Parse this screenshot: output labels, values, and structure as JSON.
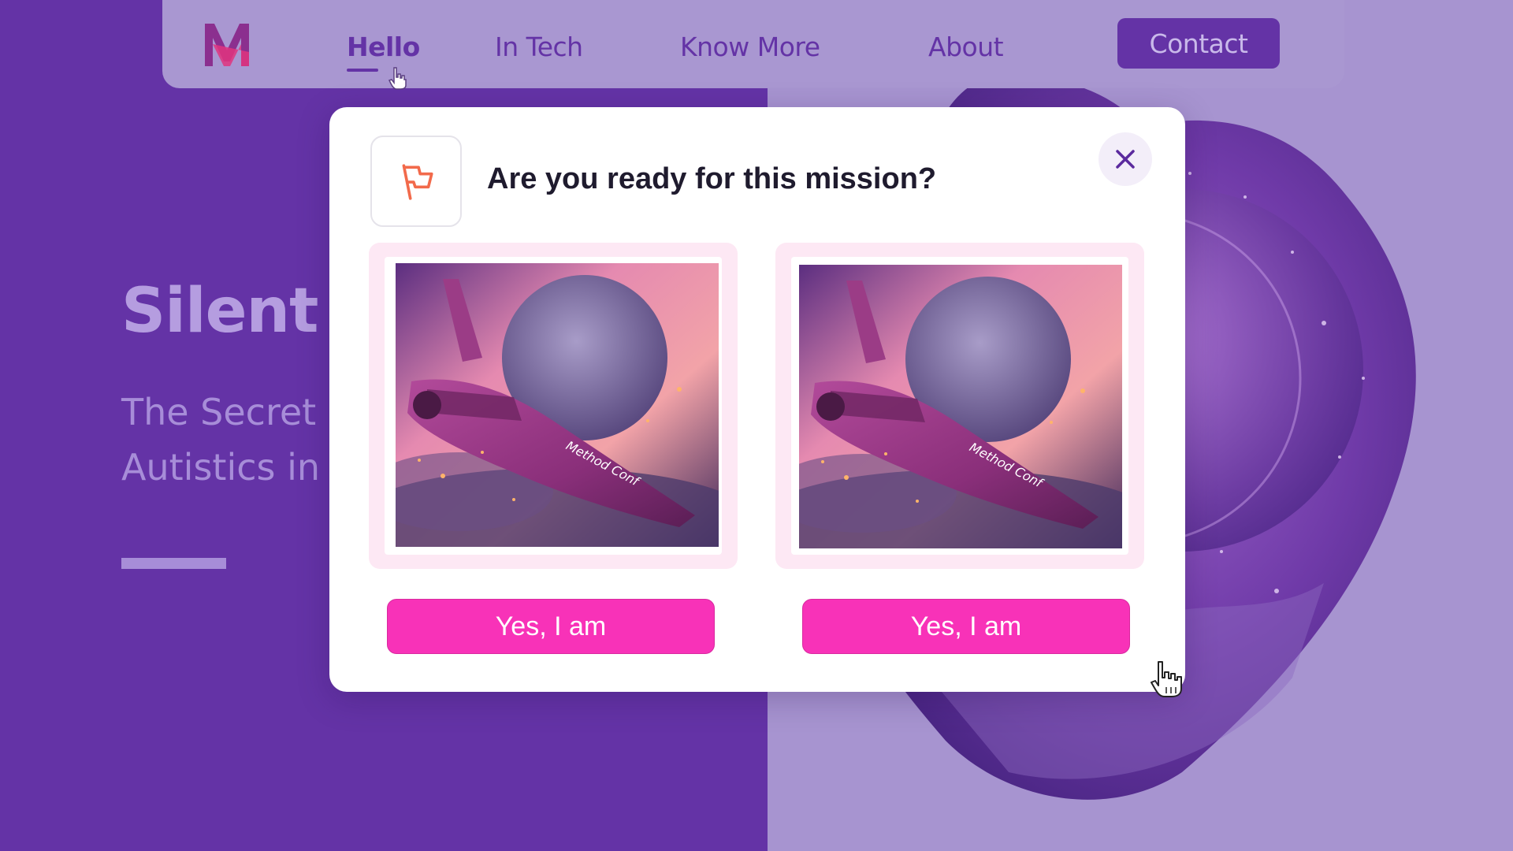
{
  "nav": {
    "logo_icon": "m-logo-icon",
    "items": [
      {
        "label": "Hello",
        "active": true
      },
      {
        "label": "In Tech",
        "active": false
      },
      {
        "label": "Know More",
        "active": false
      },
      {
        "label": "About",
        "active": false
      }
    ],
    "contact_label": "Contact"
  },
  "hero": {
    "title": "Silent I",
    "subtitle_line1": "The Secret",
    "subtitle_line2": "Autistics in"
  },
  "modal": {
    "icon": "flag-icon",
    "title": "Are you ready for this mission?",
    "close_icon": "close-icon",
    "options": [
      {
        "image": "spaceship-image",
        "ship_text": "Method Conf",
        "button_label": "Yes, I am"
      },
      {
        "image": "spaceship-image",
        "ship_text": "Method Conf",
        "button_label": "Yes, I am"
      }
    ]
  },
  "colors": {
    "primary_purple": "#6433a6",
    "light_purple": "#a794d0",
    "accent_pink": "#f832b8",
    "flag_orange": "#f26a4b"
  }
}
